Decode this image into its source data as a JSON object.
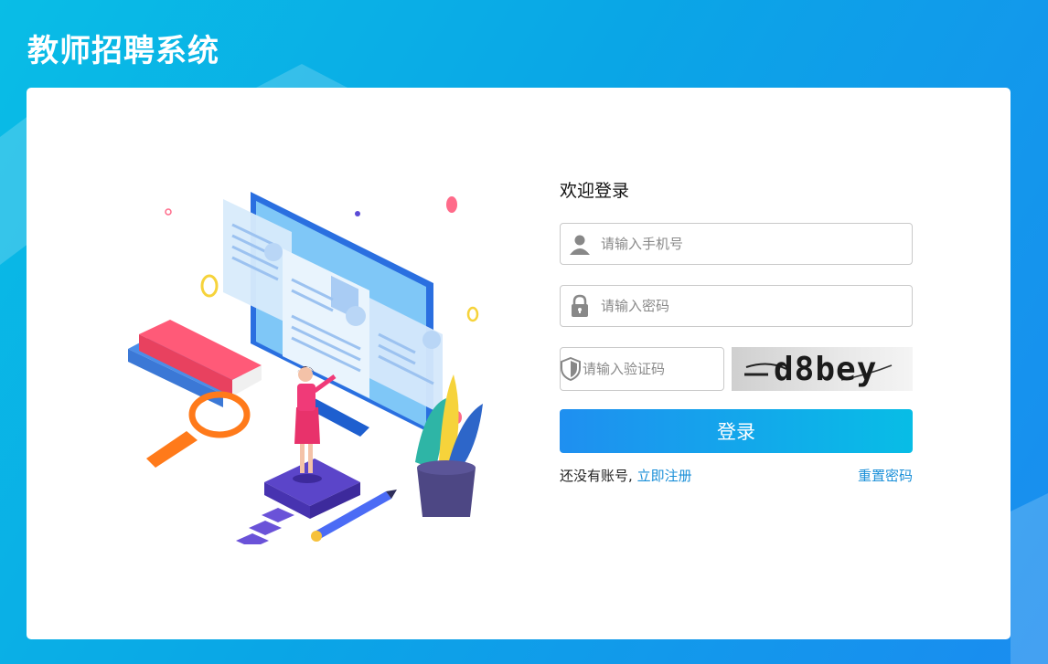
{
  "app": {
    "title": "教师招聘系统"
  },
  "login": {
    "welcome": "欢迎登录",
    "phone_placeholder": "请输入手机号",
    "password_placeholder": "请输入密码",
    "captcha_placeholder": "请输入验证码",
    "captcha_text": "d8bey",
    "submit_label": "登录",
    "no_account_text": "还没有账号,",
    "register_link": "立即注册",
    "reset_link": "重置密码"
  },
  "colors": {
    "background_start": "#09bde6",
    "background_end": "#1a8cf0",
    "button_start": "#1f8ff0",
    "button_end": "#08bde6",
    "link": "#1a8fd8"
  },
  "icons": [
    "user-icon",
    "lock-icon",
    "shield-icon"
  ]
}
